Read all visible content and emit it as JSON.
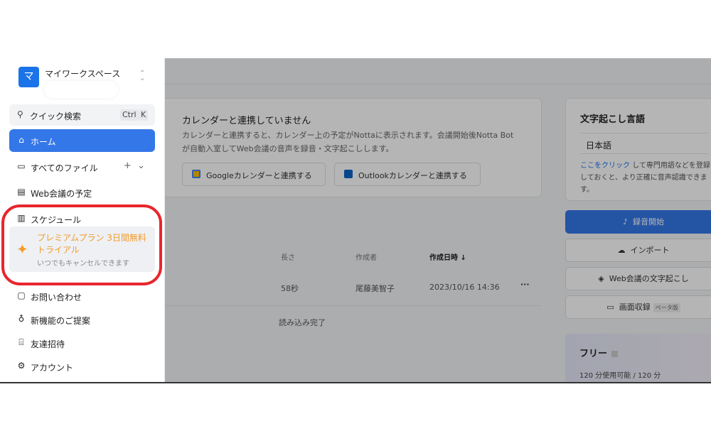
{
  "workspace": {
    "logo_letter": "マ",
    "name": "マイワークスペース",
    "switch_icon": "chevrons-updown-icon"
  },
  "search": {
    "label": "クイック検索",
    "key1": "Ctrl",
    "key2": "K"
  },
  "nav": {
    "home": "ホーム",
    "all_files": "すべてのファイル",
    "web_meeting_schedule": "Web会議の予定",
    "schedule": "スケジュール",
    "contact": "お問い合わせ",
    "feature_request": "新機能のご提案",
    "invite": "友達招待",
    "account": "アカウント"
  },
  "promo": {
    "title": "プレミアムプラン 3日間無料トライアル",
    "subtitle": "いつでもキャンセルできます"
  },
  "calendar": {
    "title": "カレンダーと連携していません",
    "description": "カレンダーと連携すると、カレンダー上の予定がNottaに表示されます。会議開始後Notta Botが自動入室してWeb会議の音声を録音・文字起こしします。",
    "google_button": "Googleカレンダーと連携する",
    "outlook_button": "Outlookカレンダーと連携する"
  },
  "table": {
    "headers": {
      "length": "長さ",
      "creator": "作成者",
      "created_at": "作成日時"
    },
    "rows": [
      {
        "length": "58秒",
        "creator": "尾藤美智子",
        "created_at": "2023/10/16 14:36",
        "more": "···"
      }
    ],
    "status": "読み込み完了"
  },
  "language": {
    "title": "文字起こし言語",
    "selected": "日本語",
    "note_link": "ここをクリック",
    "note_rest": "して専門用語などを登録しておくと、より正確に音声認識できます。"
  },
  "actions": {
    "record": "録音開始",
    "import": "インポート",
    "web_transcribe": "Web会議の文字起こし",
    "screen_record": "画面収録",
    "beta": "ベータ版"
  },
  "plan": {
    "name": "フリー",
    "usage": "120 分使用可能 / 120 分"
  },
  "colors": {
    "accent": "#3477e8",
    "promo": "#f39c2b",
    "highlight": "#e8262d"
  }
}
